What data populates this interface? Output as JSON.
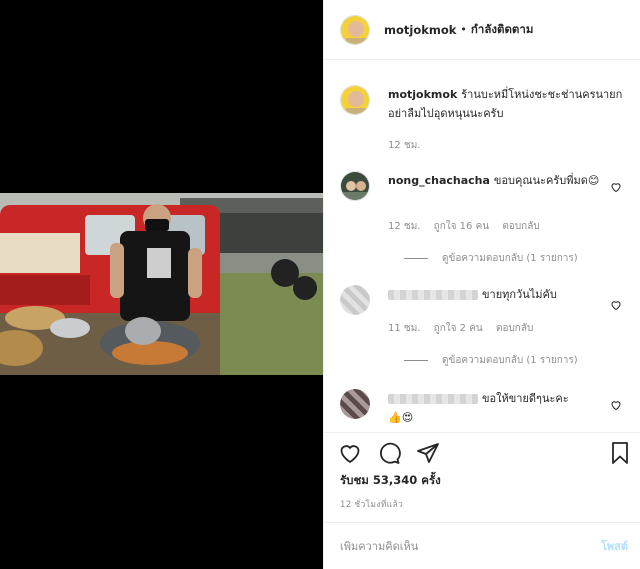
{
  "post": {
    "username": "motjokmok",
    "follow_status": "กำลังติดตาม",
    "separator": "•"
  },
  "caption": {
    "username": "motjokmok",
    "text": "ร้านบะหมี่โหน่งชะชะช่านครนายกอย่าลืมไปอุดหนุนนะครับ",
    "time": "12 ชม."
  },
  "comments": [
    {
      "username": "nong_chachacha",
      "text": "ขอบคุณนะครับพี่มด😊",
      "time": "12 ชม.",
      "likes": "ถูกใจ 16 คน",
      "reply_label": "ตอบกลับ",
      "view_replies": "ดูข้อความตอบกลับ (1 รายการ)"
    },
    {
      "username": "",
      "text": "ขายทุกวันไม่คับ",
      "time": "11 ชม.",
      "likes": "ถูกใจ 2 คน",
      "reply_label": "ตอบกลับ",
      "view_replies": "ดูข้อความตอบกลับ (1 รายการ)"
    },
    {
      "username": "",
      "text": "ขอให้ขายดีๆนะคะ",
      "emoji": "👍😍"
    }
  ],
  "stats": {
    "views": "รับชม 53,340 ครั้ง",
    "time_ago": "12 ชั่วโมงที่แล้ว"
  },
  "composer": {
    "placeholder": "เพิ่มความคิดเห็น",
    "post_label": "โพสต์"
  },
  "icons": {
    "like": "heart-icon",
    "comment": "comment-icon",
    "share": "share-icon",
    "save": "bookmark-icon"
  }
}
